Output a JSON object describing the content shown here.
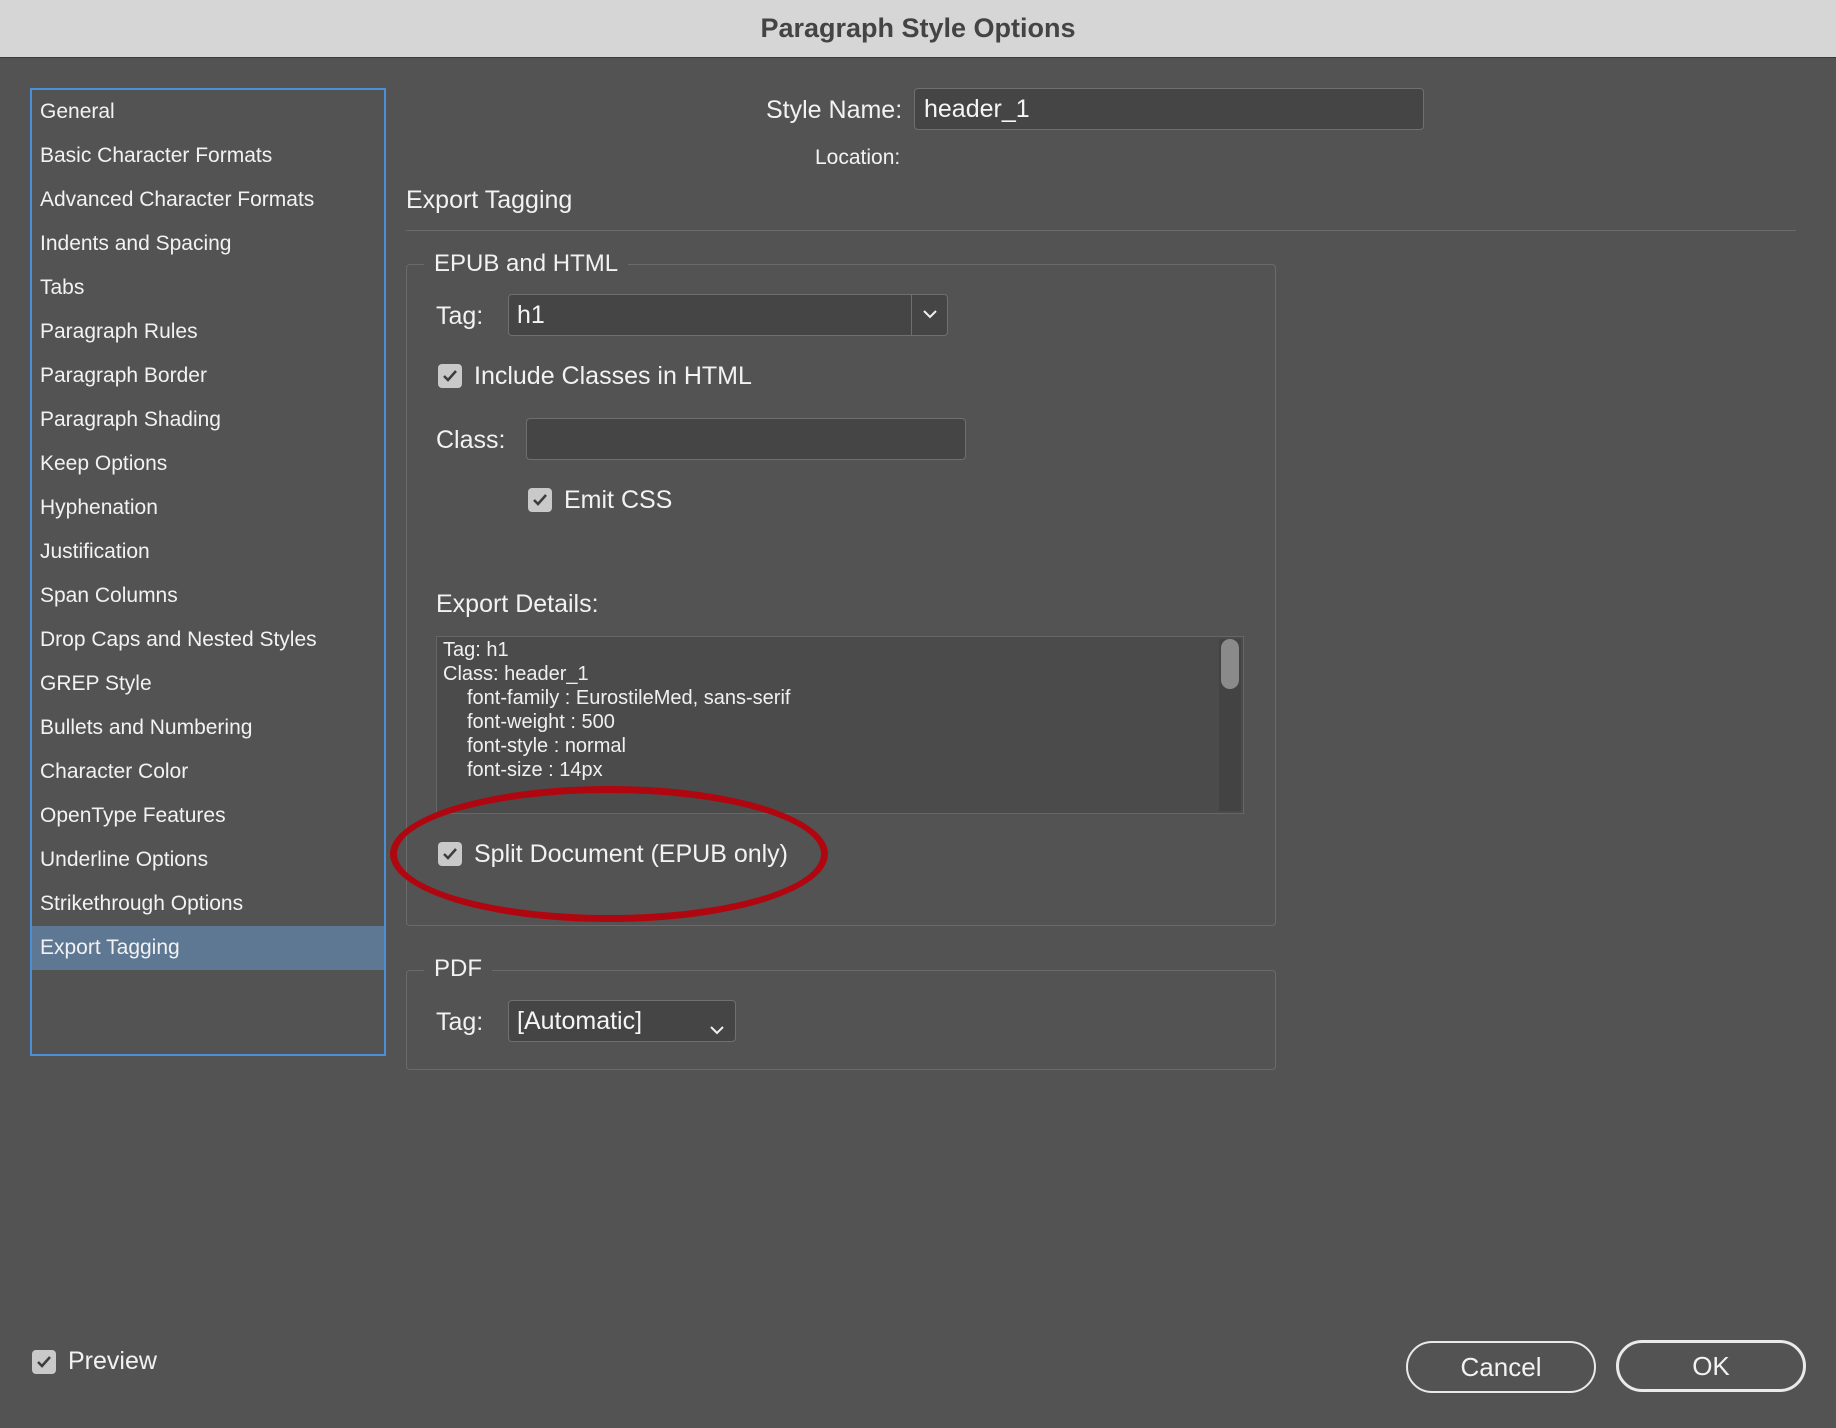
{
  "window": {
    "title": "Paragraph Style Options"
  },
  "sidebar": {
    "items": [
      {
        "label": "General",
        "selected": false
      },
      {
        "label": "Basic Character Formats",
        "selected": false
      },
      {
        "label": "Advanced Character Formats",
        "selected": false
      },
      {
        "label": "Indents and Spacing",
        "selected": false
      },
      {
        "label": "Tabs",
        "selected": false
      },
      {
        "label": "Paragraph Rules",
        "selected": false
      },
      {
        "label": "Paragraph Border",
        "selected": false
      },
      {
        "label": "Paragraph Shading",
        "selected": false
      },
      {
        "label": "Keep Options",
        "selected": false
      },
      {
        "label": "Hyphenation",
        "selected": false
      },
      {
        "label": "Justification",
        "selected": false
      },
      {
        "label": "Span Columns",
        "selected": false
      },
      {
        "label": "Drop Caps and Nested Styles",
        "selected": false
      },
      {
        "label": "GREP Style",
        "selected": false
      },
      {
        "label": "Bullets and Numbering",
        "selected": false
      },
      {
        "label": "Character Color",
        "selected": false
      },
      {
        "label": "OpenType Features",
        "selected": false
      },
      {
        "label": "Underline Options",
        "selected": false
      },
      {
        "label": "Strikethrough Options",
        "selected": false
      },
      {
        "label": "Export Tagging",
        "selected": true
      }
    ]
  },
  "header": {
    "style_name_label": "Style Name:",
    "style_name_value": "header_1",
    "location_label": "Location:",
    "section_title": "Export Tagging"
  },
  "epub": {
    "group_title": "EPUB and HTML",
    "tag_label": "Tag:",
    "tag_value": "h1",
    "include_classes_label": "Include Classes in HTML",
    "include_classes_checked": true,
    "class_label": "Class:",
    "class_value": "",
    "emit_css_label": "Emit CSS",
    "emit_css_checked": true,
    "export_details_label": "Export Details:",
    "export_details_lines": [
      "Tag: h1",
      "Class: header_1",
      "font-family : EurostileMed, sans-serif",
      "font-weight : 500",
      "font-style : normal",
      "font-size : 14px"
    ],
    "split_document_label": "Split Document (EPUB only)",
    "split_document_checked": true
  },
  "pdf": {
    "group_title": "PDF",
    "tag_label": "Tag:",
    "tag_value": "[Automatic]"
  },
  "footer": {
    "preview_label": "Preview",
    "preview_checked": true,
    "cancel_label": "Cancel",
    "ok_label": "OK"
  },
  "colors": {
    "dialog_bg": "#535353",
    "selection": "#5e7894",
    "focus_border": "#4a90d9",
    "annotation_red": "#b0060f"
  }
}
